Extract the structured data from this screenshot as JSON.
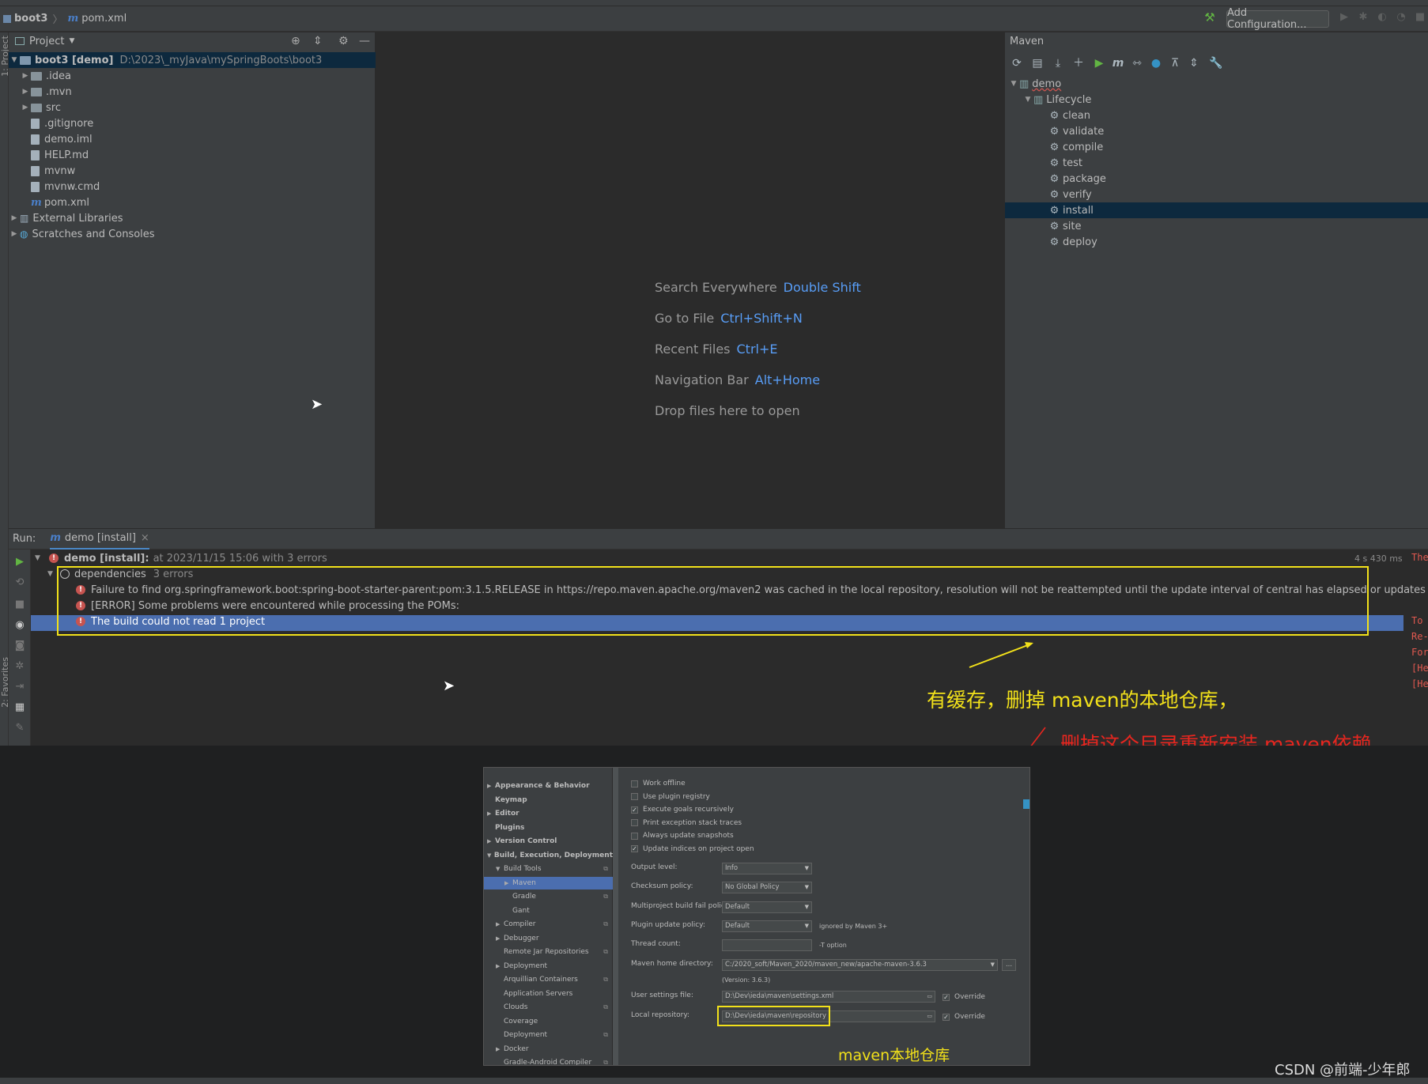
{
  "navbar": {
    "project": "boot3",
    "file": "pom.xml",
    "add_config": "Add Configuration..."
  },
  "project_panel": {
    "title": "Project",
    "root_name": "boot3 [demo]",
    "root_path": "D:\\2023\\_myJava\\mySpringBoots\\boot3",
    "items": [
      {
        "label": ".idea",
        "kind": "folder"
      },
      {
        "label": ".mvn",
        "kind": "folder"
      },
      {
        "label": "src",
        "kind": "folder"
      },
      {
        "label": ".gitignore",
        "kind": "file"
      },
      {
        "label": "demo.iml",
        "kind": "file"
      },
      {
        "label": "HELP.md",
        "kind": "file"
      },
      {
        "label": "mvnw",
        "kind": "file"
      },
      {
        "label": "mvnw.cmd",
        "kind": "file"
      },
      {
        "label": "pom.xml",
        "kind": "maven"
      }
    ],
    "external_libraries": "External Libraries",
    "scratches": "Scratches and Consoles"
  },
  "editor": {
    "hints": [
      {
        "label": "Search Everywhere",
        "key": "Double Shift"
      },
      {
        "label": "Go to File",
        "key": "Ctrl+Shift+N"
      },
      {
        "label": "Recent Files",
        "key": "Ctrl+E"
      },
      {
        "label": "Navigation Bar",
        "key": "Alt+Home"
      },
      {
        "label": "Drop files here to open",
        "key": ""
      }
    ]
  },
  "maven": {
    "title": "Maven",
    "project": "demo",
    "lifecycle": "Lifecycle",
    "goals": [
      "clean",
      "validate",
      "compile",
      "test",
      "package",
      "verify",
      "install",
      "site",
      "deploy"
    ],
    "selected_goal": "install"
  },
  "run": {
    "label": "Run:",
    "tab": "demo [install]",
    "root": "demo [install]:",
    "root_detail": "at 2023/11/15 15:06 with 3 errors",
    "duration": "4 s 430 ms",
    "group": "dependencies",
    "group_count": "3 errors",
    "errors": [
      "Failure to find org.springframework.boot:spring-boot-starter-parent:pom:3.1.5.RELEASE in https://repo.maven.apache.org/maven2 was cached in the local repository, resolution will not be reattempted until the update interval of central has elapsed or updates are forced",
      "[ERROR] Some problems were encountered while processing the POMs:",
      "The build could not read 1 project"
    ],
    "right_lines": [
      "The",
      "",
      "",
      "",
      "To",
      "Re-",
      "For",
      "[He",
      "[He"
    ]
  },
  "annotations": {
    "cache_note": "有缓存，删掉 maven的本地仓库，",
    "delete_note": "删掉这个目录重新安装 maven依赖",
    "local_repo_note": "maven本地仓库",
    "watermark": "CSDN @前端-少年郎"
  },
  "settings": {
    "tree": [
      {
        "label": "Appearance & Behavior",
        "bold": true,
        "arrow": "▶",
        "indent": 0
      },
      {
        "label": "Keymap",
        "bold": true,
        "arrow": "",
        "indent": 0
      },
      {
        "label": "Editor",
        "bold": true,
        "arrow": "▶",
        "indent": 0
      },
      {
        "label": "Plugins",
        "bold": true,
        "arrow": "",
        "indent": 0
      },
      {
        "label": "Version Control",
        "bold": true,
        "arrow": "▶",
        "indent": 0
      },
      {
        "label": "Build, Execution, Deployment",
        "bold": true,
        "arrow": "▼",
        "indent": 0
      },
      {
        "label": "Build Tools",
        "bold": false,
        "arrow": "▼",
        "indent": 1
      },
      {
        "label": "Maven",
        "bold": false,
        "arrow": "▶",
        "indent": 2
      },
      {
        "label": "Gradle",
        "bold": false,
        "arrow": "",
        "indent": 2
      },
      {
        "label": "Gant",
        "bold": false,
        "arrow": "",
        "indent": 2
      },
      {
        "label": "Compiler",
        "bold": false,
        "arrow": "▶",
        "indent": 1
      },
      {
        "label": "Debugger",
        "bold": false,
        "arrow": "▶",
        "indent": 1
      },
      {
        "label": "Remote Jar Repositories",
        "bold": false,
        "arrow": "",
        "indent": 1
      },
      {
        "label": "Deployment",
        "bold": false,
        "arrow": "▶",
        "indent": 1
      },
      {
        "label": "Arquillian Containers",
        "bold": false,
        "arrow": "",
        "indent": 1
      },
      {
        "label": "Application Servers",
        "bold": false,
        "arrow": "",
        "indent": 1
      },
      {
        "label": "Clouds",
        "bold": false,
        "arrow": "",
        "indent": 1
      },
      {
        "label": "Coverage",
        "bold": false,
        "arrow": "",
        "indent": 1
      },
      {
        "label": "Deployment",
        "bold": false,
        "arrow": "",
        "indent": 1
      },
      {
        "label": "Docker",
        "bold": false,
        "arrow": "▶",
        "indent": 1
      },
      {
        "label": "Gradle-Android Compiler",
        "bold": false,
        "arrow": "",
        "indent": 1
      }
    ],
    "checkboxes": [
      {
        "label": "Work offline",
        "checked": false
      },
      {
        "label": "Use plugin registry",
        "checked": false
      },
      {
        "label": "Execute goals recursively",
        "checked": true
      },
      {
        "label": "Print exception stack traces",
        "checked": false
      },
      {
        "label": "Always update snapshots",
        "checked": false
      },
      {
        "label": "Update indices on project open",
        "checked": true
      }
    ],
    "output_level_label": "Output level:",
    "output_level": "Info",
    "checksum_label": "Checksum policy:",
    "checksum": "No Global Policy",
    "multiproject_label": "Multiproject build fail policy:",
    "multiproject": "Default",
    "plugin_update_label": "Plugin update policy:",
    "plugin_update": "Default",
    "plugin_update_note": "ignored by Maven 3+",
    "thread_label": "Thread count:",
    "thread_note": "-T option",
    "maven_home_label": "Maven home directory:",
    "maven_home": "C:/2020_soft/Maven_2020/maven_new/apache-maven-3.6.3",
    "version": "(Version: 3.6.3)",
    "user_settings_label": "User settings file:",
    "user_settings": "D:\\Dev\\ieda\\maven\\settings.xml",
    "local_repo_label": "Local repository:",
    "local_repo": "D:\\Dev\\ieda\\maven\\repository",
    "override": "Override",
    "browse": "..."
  }
}
